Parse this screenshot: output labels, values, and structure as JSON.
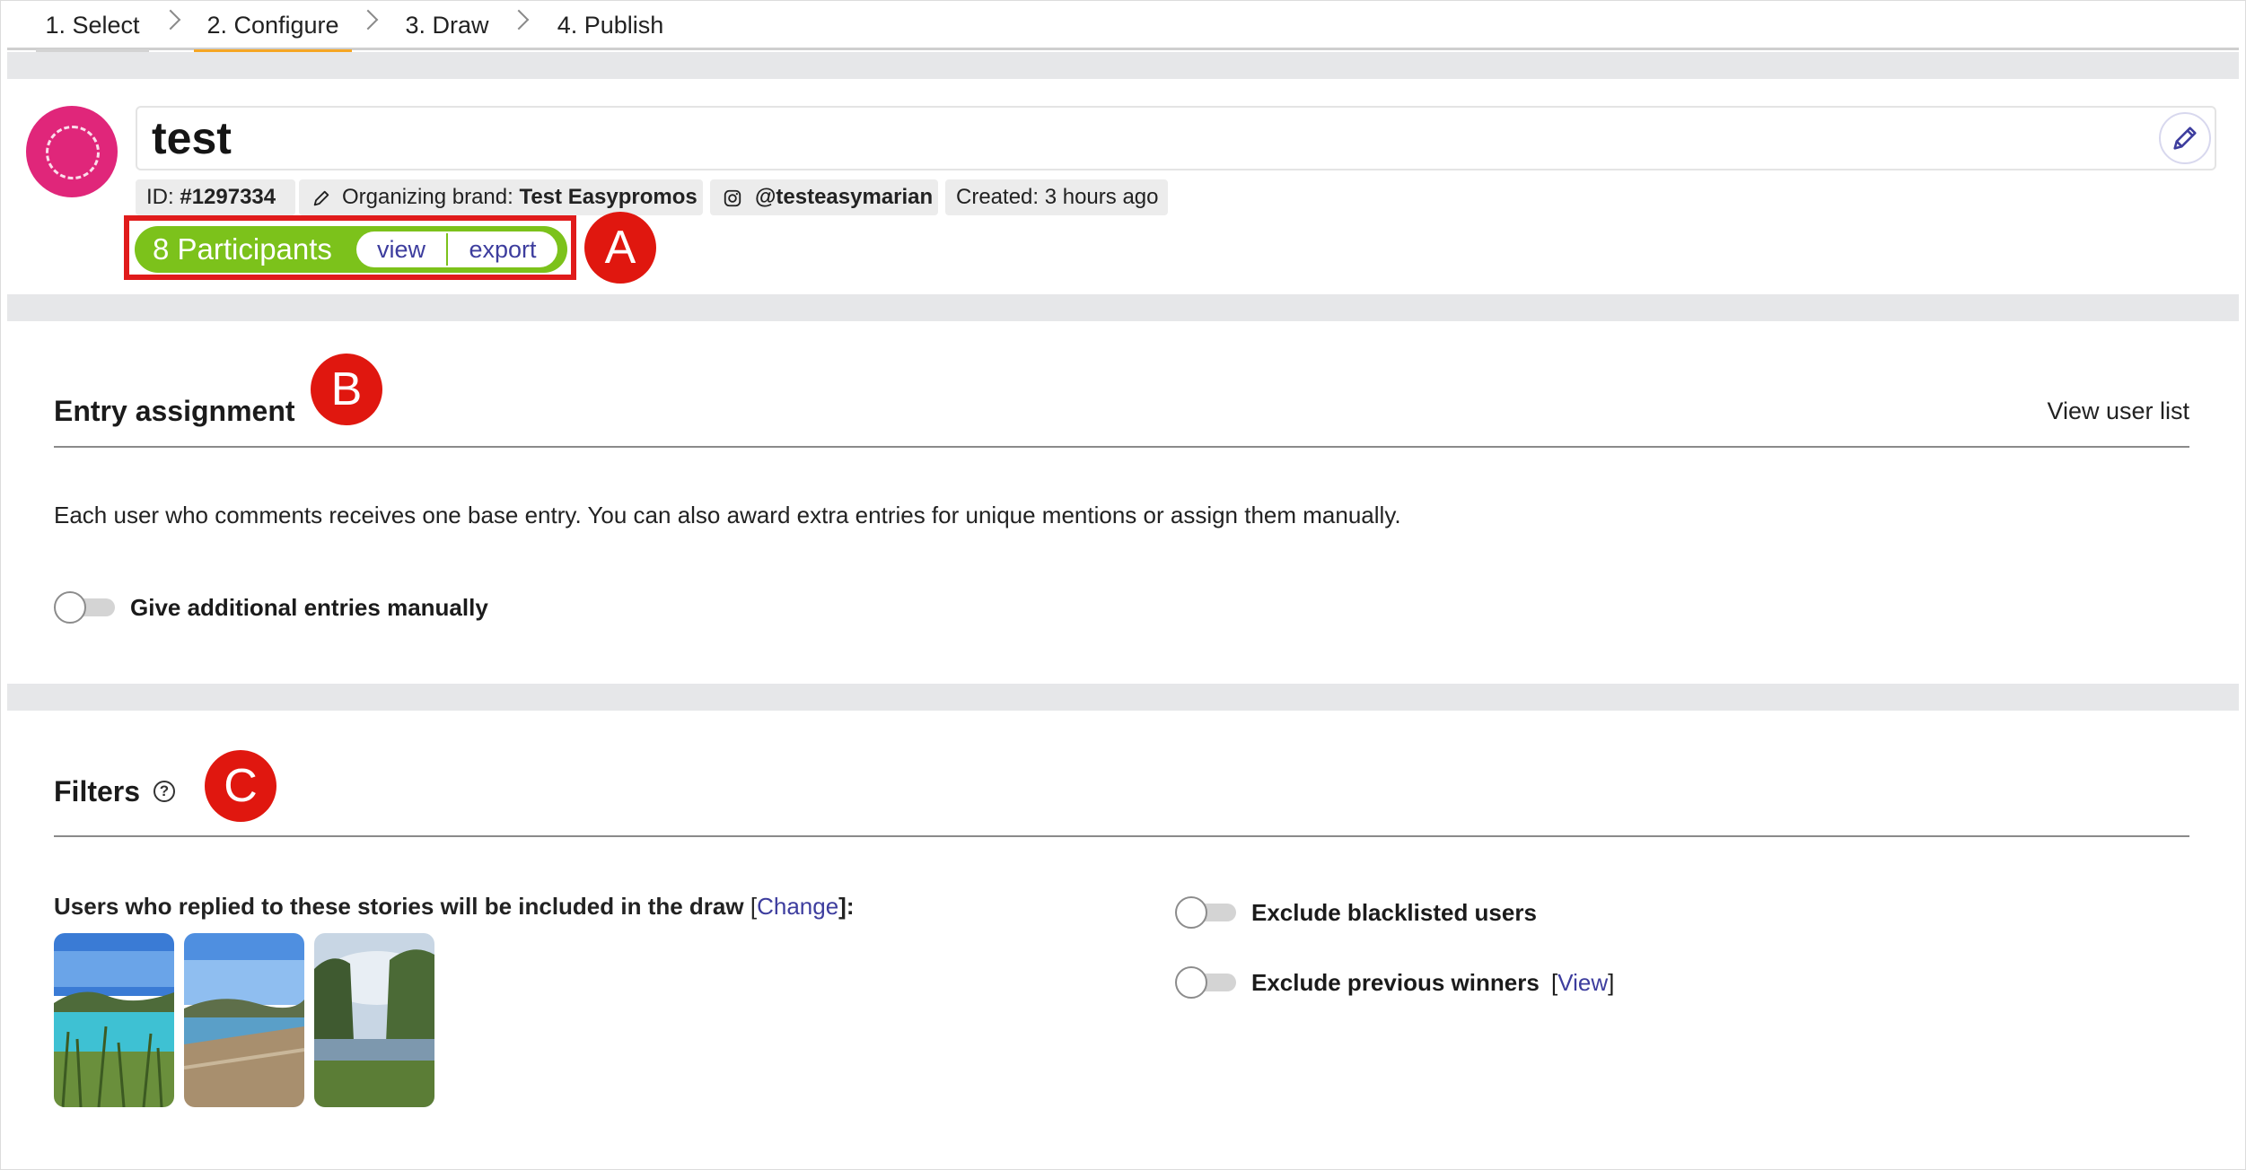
{
  "stepper": {
    "steps": [
      {
        "label": "1. Select"
      },
      {
        "label": "2. Configure"
      },
      {
        "label": "3. Draw"
      },
      {
        "label": "4. Publish"
      }
    ]
  },
  "header": {
    "title": "test",
    "id_label": "ID: ",
    "id_value": "#1297334",
    "brand_label": "Organizing brand: ",
    "brand_value": "Test Easypromos",
    "account": "@testeasymarian",
    "created": "Created: 3 hours ago"
  },
  "participants": {
    "count_text": "8 Participants",
    "view_label": "view",
    "export_label": "export"
  },
  "markers": {
    "a": "A",
    "b": "B",
    "c": "C"
  },
  "entry_assignment": {
    "title": "Entry assignment",
    "view_user_list": "View user list",
    "description": "Each user who comments receives one base entry. You can also award extra entries for unique mentions or assign them manually.",
    "toggle_label": "Give additional entries manually"
  },
  "filters": {
    "title": "Filters",
    "help_icon_text": "?",
    "stories_text": "Users who replied to these stories will be included in the draw",
    "bracket_open": "[",
    "change_label": "Change",
    "bracket_close_colon": "]:",
    "exclude_blacklisted": "Exclude blacklisted users",
    "exclude_winners": "Exclude previous winners",
    "view_open": "[",
    "view_label": "View",
    "view_close": "]"
  },
  "colors": {
    "accent_step": "#f5a623",
    "participants_green": "#7cc21b",
    "link": "#3d3d9e",
    "avatar": "#e0267a",
    "annotation_red": "#e0170f"
  }
}
